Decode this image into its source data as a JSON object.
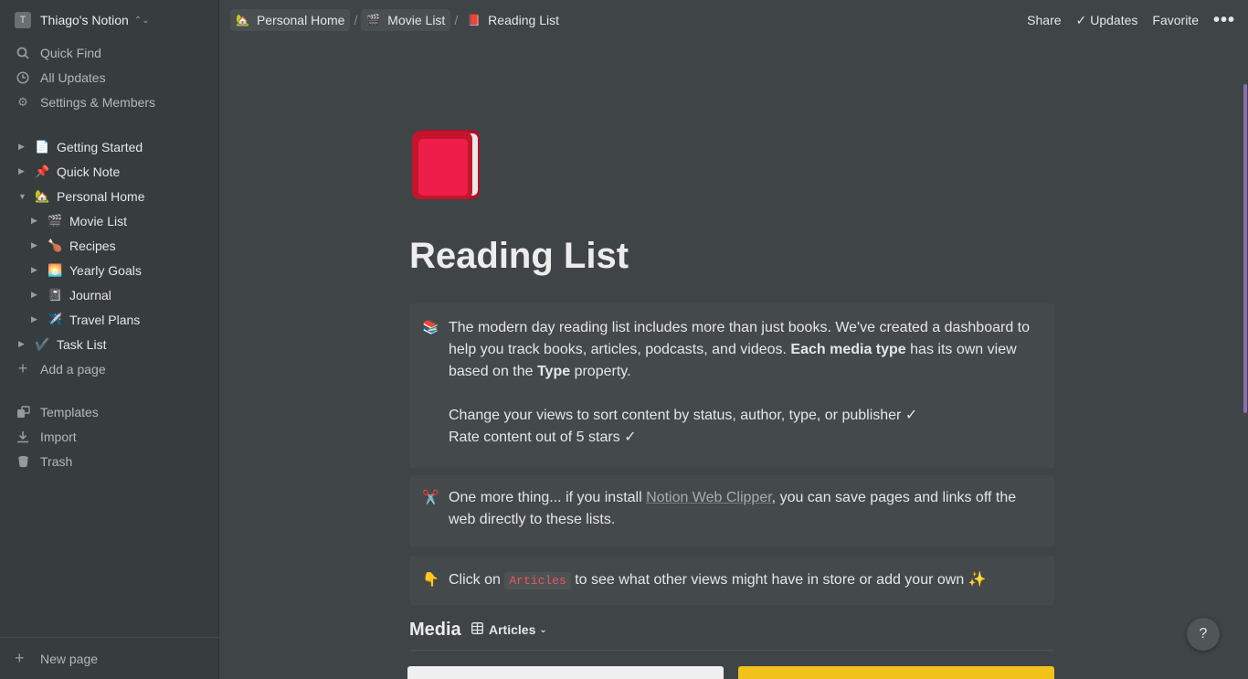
{
  "workspace": {
    "avatar": "T",
    "name": "Thiago's Notion"
  },
  "sidebar": {
    "nav": [
      {
        "label": "Quick Find",
        "icon": "search-icon"
      },
      {
        "label": "All Updates",
        "icon": "clock-icon"
      },
      {
        "label": "Settings & Members",
        "icon": "gear-icon"
      }
    ],
    "pages": [
      {
        "label": "Getting Started",
        "emoji": "📄"
      },
      {
        "label": "Quick Note",
        "emoji": "📌"
      },
      {
        "label": "Personal Home",
        "emoji": "🏡"
      },
      {
        "label": "Movie List",
        "emoji": "🎬"
      },
      {
        "label": "Recipes",
        "emoji": "🍗"
      },
      {
        "label": "Yearly Goals",
        "emoji": "🌅"
      },
      {
        "label": "Journal",
        "emoji": "📓"
      },
      {
        "label": "Travel Plans",
        "emoji": "✈️"
      },
      {
        "label": "Task List",
        "emoji": "✔️"
      }
    ],
    "add_page": "Add a page",
    "tools": [
      {
        "label": "Templates",
        "icon": "templates-icon"
      },
      {
        "label": "Import",
        "icon": "import-icon"
      },
      {
        "label": "Trash",
        "icon": "trash-icon"
      }
    ],
    "new_page": "New page"
  },
  "breadcrumb": [
    {
      "label": "Personal Home",
      "emoji": "🏡"
    },
    {
      "label": "Movie List",
      "emoji": "🎬"
    },
    {
      "label": "Reading List",
      "emoji": "📕"
    }
  ],
  "topbar": {
    "share": "Share",
    "updates": "Updates",
    "favorite": "Favorite",
    "more": "•••"
  },
  "page": {
    "title": "Reading List",
    "callouts": {
      "intro_icon": "📚",
      "intro_line1": "The modern day reading list includes more than just books. We've created a dashboard to help you track books, articles, podcasts, and videos. ",
      "intro_bold1": "Each media type",
      "intro_line2": " has its own view based on the ",
      "intro_bold2": "Type",
      "intro_line3": " property.",
      "bullet1": "Change your views to sort content by status, author, type, or publisher ✓",
      "bullet2": "Rate content out of 5 stars ✓",
      "clipper_icon": "✂️",
      "clipper_pre": "One more thing... if you install ",
      "clipper_link": "Notion Web Clipper",
      "clipper_post": ", you can save pages and links off the web directly to these lists.",
      "click_icon": "👇",
      "click_pre": "Click on ",
      "click_code": "Articles",
      "click_post": " to see what other views might have in store or add your own ✨"
    },
    "media_heading": "Media",
    "view_name": "Articles"
  },
  "help": "?"
}
